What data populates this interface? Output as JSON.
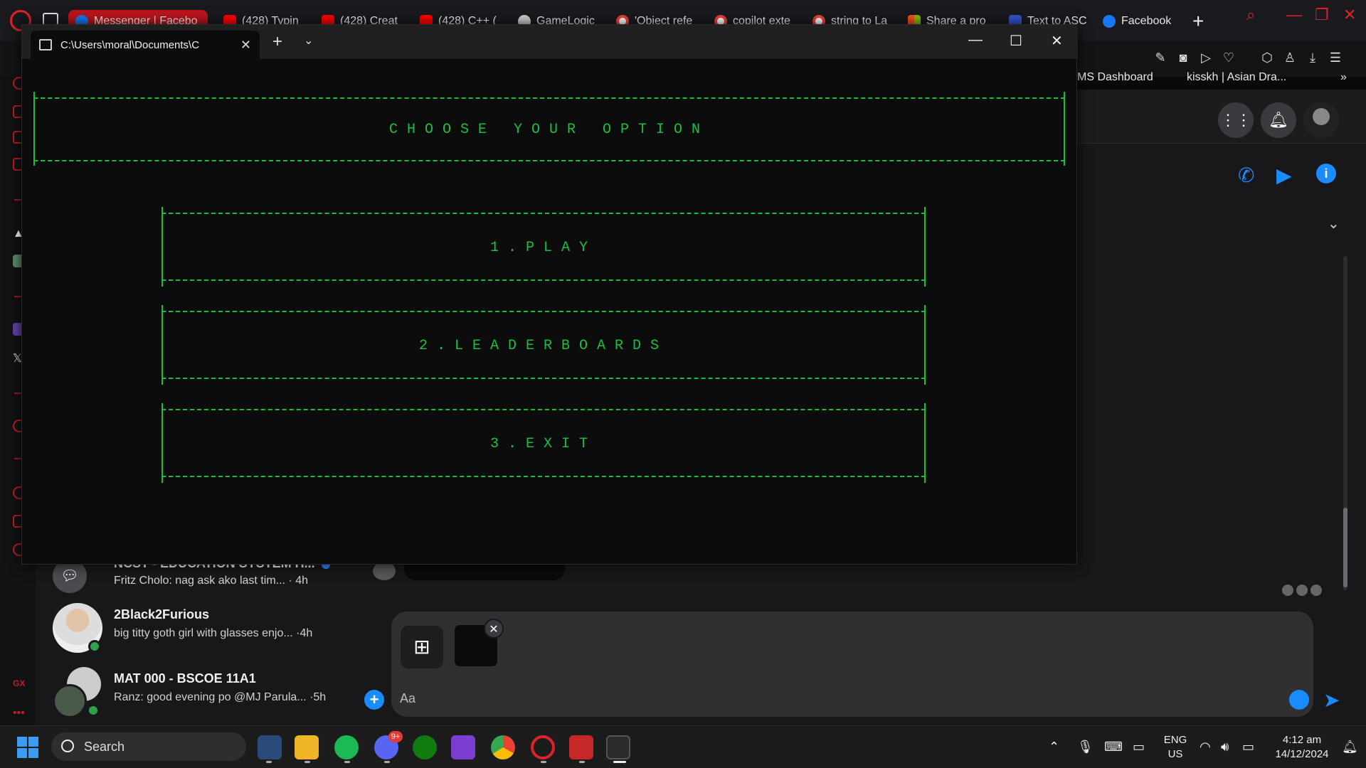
{
  "browser": {
    "tabs": [
      {
        "label": "Messenger | Facebo",
        "favicon": "facebook-icon"
      },
      {
        "label": "(428) Typin",
        "favicon": "youtube-icon"
      },
      {
        "label": "(428) Creat",
        "favicon": "youtube-icon"
      },
      {
        "label": "(428) C++ (",
        "favicon": "youtube-icon"
      },
      {
        "label": "GameLogic",
        "favicon": "chatgpt-icon"
      },
      {
        "label": "'Object refe",
        "favicon": "google-icon"
      },
      {
        "label": "copilot exte",
        "favicon": "google-icon"
      },
      {
        "label": "string to La",
        "favicon": "google-icon"
      },
      {
        "label": "Share a pro",
        "favicon": "microsoft-icon"
      },
      {
        "label": "Text to ASC",
        "favicon": "text-icon"
      },
      {
        "label": "Facebook",
        "favicon": "facebook-icon"
      }
    ],
    "bookmarks": [
      {
        "label": "MS Dashboard"
      },
      {
        "label": "kisskh | Asian Dra..."
      }
    ],
    "accent": "#e0212b"
  },
  "terminal": {
    "tab_title": "C:\\Users\\moral\\Documents\\C",
    "heading": "CHOOSE YOUR OPTION",
    "options": [
      {
        "label": "1.PLAY"
      },
      {
        "label": "2.LEADERBOARDS"
      },
      {
        "label": "3.EXIT"
      }
    ],
    "text_color": "#13c13a"
  },
  "messenger": {
    "chats": [
      {
        "name": "NCST - EDUCATION SYSTEM H...",
        "snippet": "Fritz Cholo: nag ask ako last tim...",
        "time": "4h",
        "unread": true
      },
      {
        "name": "2Black2Furious",
        "snippet": "big titty goth girl with glasses enjo...",
        "time": "4h",
        "online": true
      },
      {
        "name": "MAT 000 - BSCOE 11A1",
        "snippet": "Ranz: good evening po @MJ Parula...",
        "time": "5h",
        "online": true
      }
    ],
    "composer_placeholder": "Aa",
    "accent": "#1a8cff"
  },
  "taskbar": {
    "search_placeholder": "Search",
    "discord_badge": "9+",
    "language": "ENG",
    "region": "US",
    "time": "4:12 am",
    "date": "14/12/2024"
  }
}
